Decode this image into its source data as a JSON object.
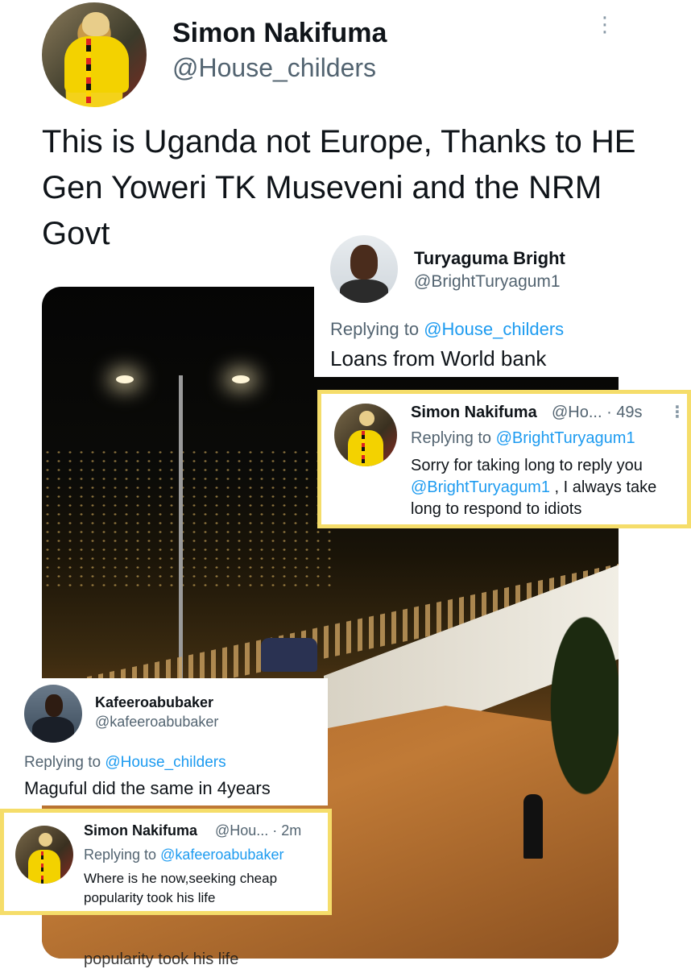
{
  "main_tweet": {
    "name": "Simon Nakifuma",
    "handle": "@House_childers",
    "more_glyph": "⋮",
    "text": "This is Uganda not Europe,  Thanks to HE Gen Yoweri TK Museveni and the NRM Govt"
  },
  "replies": [
    {
      "name": "Turyaguma Bright",
      "handle": "@BrightTuryagum1",
      "replying_prefix": "Replying to",
      "replying_to": "@House_childers",
      "text": "Loans from World bank"
    },
    {
      "name": "Simon Nakifuma",
      "handle_time": "@Ho...  · 49s",
      "more_glyph": "⋮",
      "replying_prefix": "Replying to",
      "replying_to": "@BrightTuryagum1",
      "text_1": "Sorry for taking long to reply you",
      "text_mention": "@BrightTuryagum1",
      "text_2": " , I always take long to respond to idiots"
    },
    {
      "name": "Kafeeroabubaker",
      "handle": "@kafeeroabubaker",
      "replying_prefix": "Replying to",
      "replying_to": "@House_childers",
      "text": "Maguful did the same in 4years"
    },
    {
      "name": "Simon Nakifuma",
      "handle_time": "@Hou... · 2m",
      "replying_prefix": "Replying to",
      "replying_to": "@kafeeroabubaker",
      "text": "Where is he now,seeking  cheap popularity took his life"
    }
  ],
  "cropped_bottom_text": "popularity took his life",
  "colors": {
    "link": "#1d9bf0",
    "secondary": "#536471",
    "highlight_border": "#f5dd6a"
  }
}
